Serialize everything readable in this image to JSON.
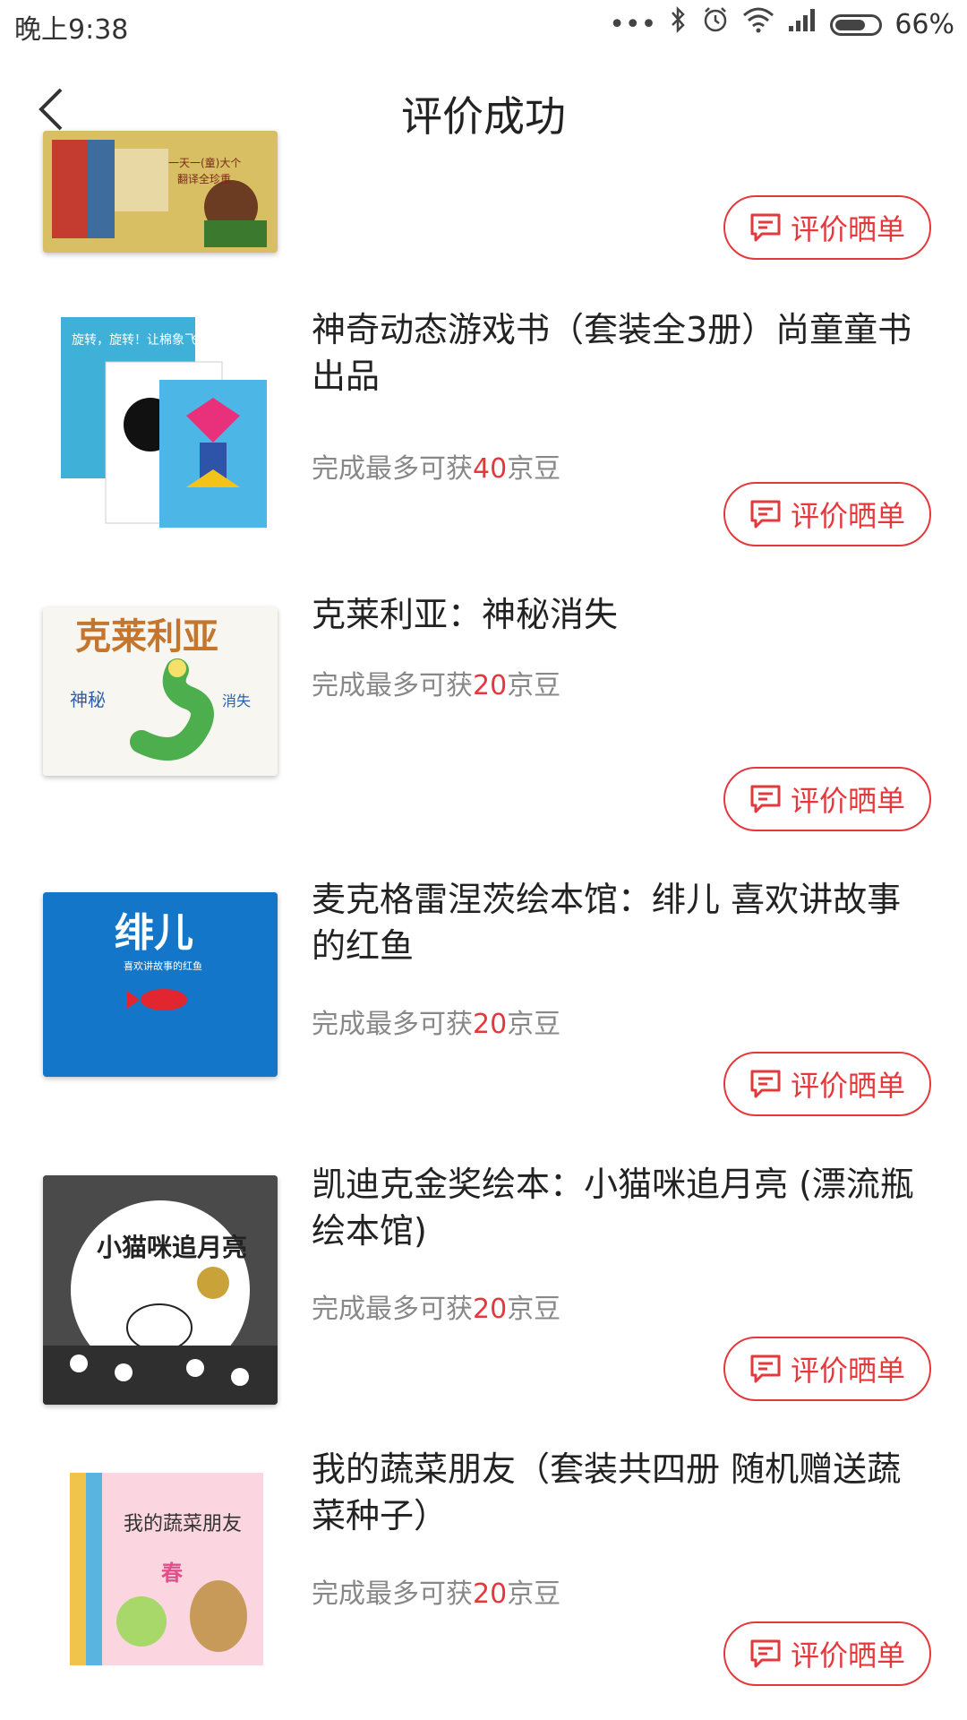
{
  "status_bar": {
    "time": "晚上9:38",
    "battery": "66%",
    "icons": [
      "more-dots-icon",
      "bluetooth-icon",
      "alarm-icon",
      "wifi-icon",
      "signal-icon",
      "battery-icon"
    ]
  },
  "header": {
    "title": "评价成功",
    "back_icon": "chevron-left-icon"
  },
  "accent_color": "#e4393c",
  "products": [
    {
      "title": "",
      "points_prefix": "",
      "points_value": "",
      "points_suffix": "",
      "button_label": "评价晒单",
      "cover_text": "一天一(童)大个(奇)兔\n翻译全珍重"
    },
    {
      "title": "神奇动态游戏书（套装全3册）尚童童书出品",
      "points_prefix": "完成最多可获",
      "points_value": "40",
      "points_suffix": "京豆",
      "button_label": "评价晒单",
      "cover_text": "旋转，旋转！让棉象飞！"
    },
    {
      "title": "克莱利亚：神秘消失",
      "points_prefix": "完成最多可获",
      "points_value": "20",
      "points_suffix": "京豆",
      "button_label": "评价晒单",
      "cover_text": "克莱利亚"
    },
    {
      "title": "麦克格雷涅茨绘本馆：绯儿 喜欢讲故事的红鱼",
      "points_prefix": "完成最多可获",
      "points_value": "20",
      "points_suffix": "京豆",
      "button_label": "评价晒单",
      "cover_text": "绯儿"
    },
    {
      "title": "凯迪克金奖绘本：小猫咪追月亮 (漂流瓶绘本馆)",
      "points_prefix": "完成最多可获",
      "points_value": "20",
      "points_suffix": "京豆",
      "button_label": "评价晒单",
      "cover_text": "小猫咪追月亮"
    },
    {
      "title": "我的蔬菜朋友（套装共四册  随机赠送蔬菜种子）",
      "points_prefix": "完成最多可获",
      "points_value": "20",
      "points_suffix": "京豆",
      "button_label": "评价晒单",
      "cover_text": "我的蔬菜朋友"
    }
  ]
}
